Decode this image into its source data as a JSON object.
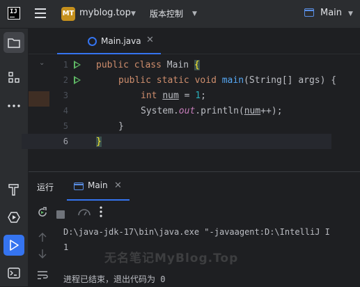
{
  "header": {
    "logo_text": "IJ",
    "project_badge": "MT",
    "project_name": "myblog.top",
    "vcs_label": "版本控制",
    "run_config": "Main"
  },
  "editor": {
    "tab_label": "Main.java",
    "lines": [
      "1",
      "2",
      "3",
      "4",
      "5",
      "6"
    ],
    "code": {
      "l1_kw1": "public",
      "l1_kw2": "class",
      "l1_name": "Main",
      "l1_brace": "{",
      "l2_kw1": "public",
      "l2_kw2": "static",
      "l2_kw3": "void",
      "l2_fn": "main",
      "l2_rest": "(String[] args) {",
      "l3_kw": "int",
      "l3_var": "num",
      "l3_op": " = ",
      "l3_num": "1",
      "l3_end": ";",
      "l4_obj": "System.",
      "l4_fld": "out",
      "l4_call": ".println(",
      "l4_var": "num",
      "l4_end": "++);",
      "l5": "}",
      "l6": "}"
    }
  },
  "run_panel": {
    "title": "运行",
    "tab_label": "Main",
    "output": {
      "cmd": "D:\\java-jdk-17\\bin\\java.exe \"-javaagent:D:\\IntelliJ I",
      "result": "1",
      "exit": "进程已结束，退出代码为 0"
    },
    "watermark": "无名笔记MyBlog.Top"
  },
  "colors": {
    "accent": "#3574f0",
    "run_green": "#5fb865",
    "badge": "#c5901d"
  }
}
